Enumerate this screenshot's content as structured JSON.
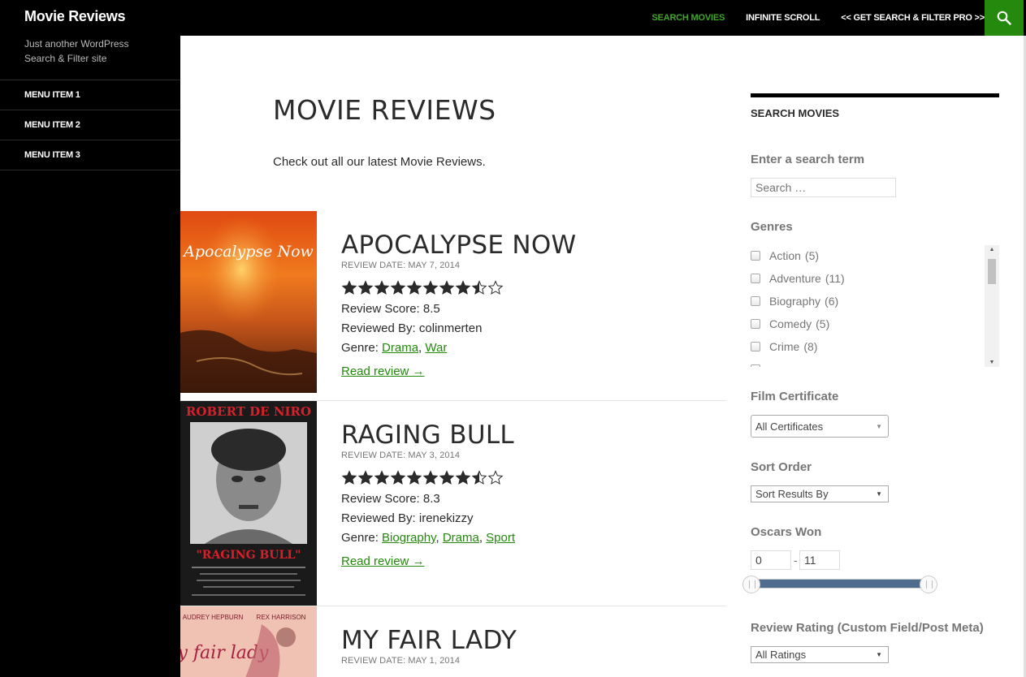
{
  "site": {
    "title": "Movie Reviews",
    "tagline": "Just another WordPress Search & Filter site"
  },
  "topnav": {
    "items": [
      {
        "label": "SEARCH MOVIES",
        "active": true
      },
      {
        "label": "INFINITE SCROLL",
        "active": false
      },
      {
        "label": "<< GET SEARCH & FILTER PRO >>",
        "active": false
      }
    ],
    "search_icon": "search-icon"
  },
  "sidebar": {
    "items": [
      {
        "label": "MENU ITEM 1"
      },
      {
        "label": "MENU ITEM 2"
      },
      {
        "label": "MENU ITEM 3"
      }
    ]
  },
  "main": {
    "heading": "MOVIE REVIEWS",
    "intro": "Check out all our latest Movie Reviews.",
    "genre_prefix": "Genre:",
    "read_more": "Read review →",
    "movies": [
      {
        "title": "APOCALYPSE NOW",
        "date": "REVIEW DATE: MAY 7, 2014",
        "rating": 8.5,
        "score": "Review Score: 8.5",
        "reviewer": "Reviewed By: colinmerten",
        "genres": [
          "Drama",
          "War"
        ],
        "poster_text": "Apocalypse Now"
      },
      {
        "title": "RAGING BULL",
        "date": "REVIEW DATE: MAY 3, 2014",
        "rating": 8.3,
        "score": "Review Score: 8.3",
        "reviewer": "Reviewed By: irenekizzy",
        "genres": [
          "Biography",
          "Drama",
          "Sport"
        ],
        "poster_text": "ROBERT DE NIRO",
        "poster_sub": "\"RAGING BULL\""
      },
      {
        "title": "MY FAIR LADY",
        "date": "REVIEW DATE: MAY 1, 2014",
        "poster_text": "AUDREY HEPBURN",
        "poster_text2": "REX HARRISON",
        "poster_sub": "my fair lady"
      }
    ]
  },
  "widget": {
    "title": "SEARCH MOVIES",
    "search_label": "Enter a search term",
    "search_placeholder": "Search …",
    "genres_label": "Genres",
    "genres": [
      {
        "name": "Action",
        "count": "(5)"
      },
      {
        "name": "Adventure",
        "count": "(11)"
      },
      {
        "name": "Biography",
        "count": "(6)"
      },
      {
        "name": "Comedy",
        "count": "(5)"
      },
      {
        "name": "Crime",
        "count": "(8)"
      }
    ],
    "certificate_label": "Film Certificate",
    "certificate_value": "All Certificates",
    "sort_label": "Sort Order",
    "sort_value": "Sort Results By",
    "oscars_label": "Oscars Won",
    "oscars_min": "0",
    "oscars_max": "11",
    "oscars_dash": "-",
    "rating_label": "Review Rating (Custom Field/Post Meta)",
    "rating_value": "All Ratings"
  },
  "colors": {
    "accent": "#24890d",
    "active_nav": "#41a62a",
    "slider": "#4f6c8f"
  }
}
